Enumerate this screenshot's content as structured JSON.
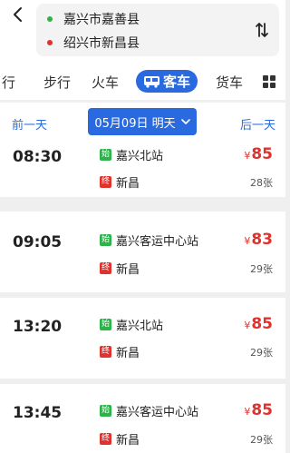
{
  "route": {
    "from": "嘉兴市嘉善县",
    "to": "绍兴市新昌县"
  },
  "tabs": [
    {
      "label": "行"
    },
    {
      "label": "步行"
    },
    {
      "label": "火车"
    },
    {
      "label": "客车"
    },
    {
      "label": "货车"
    }
  ],
  "datebar": {
    "prev": "前一天",
    "current": "05月09日 明天",
    "next": "后一天"
  },
  "labels": {
    "start_badge": "始",
    "end_badge": "终",
    "currency": "¥"
  },
  "trips": [
    {
      "time": "08:30",
      "from": "嘉兴北站",
      "to": "新昌",
      "price": "85",
      "tickets": "28张"
    },
    {
      "time": "09:05",
      "from": "嘉兴客运中心站",
      "to": "新昌",
      "price": "83",
      "tickets": "29张"
    },
    {
      "time": "13:20",
      "from": "嘉兴北站",
      "to": "新昌",
      "price": "85",
      "tickets": "29张"
    },
    {
      "time": "13:45",
      "from": "嘉兴客运中心站",
      "to": "新昌",
      "price": "85",
      "tickets": "29张"
    }
  ],
  "colors": {
    "accent": "#2a6ae0",
    "start": "#2cb34a",
    "end_price": "#e0312d"
  }
}
